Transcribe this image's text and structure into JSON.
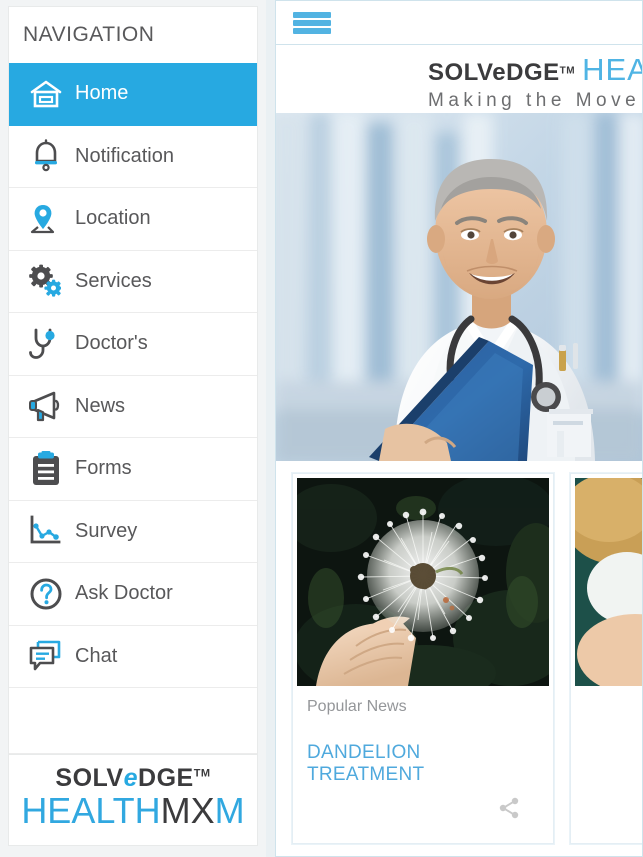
{
  "sidebar": {
    "header": "NAVIGATION",
    "items": [
      {
        "label": "Home",
        "icon": "home-icon",
        "active": true
      },
      {
        "label": "Notification",
        "icon": "bell-icon",
        "active": false
      },
      {
        "label": "Location",
        "icon": "map-pin-icon",
        "active": false
      },
      {
        "label": "Services",
        "icon": "gears-icon",
        "active": false
      },
      {
        "label": "Doctor's",
        "icon": "stethoscope-icon",
        "active": false
      },
      {
        "label": "News",
        "icon": "megaphone-icon",
        "active": false
      },
      {
        "label": "Forms",
        "icon": "clipboard-icon",
        "active": false
      },
      {
        "label": "Survey",
        "icon": "line-chart-icon",
        "active": false
      },
      {
        "label": "Ask Doctor",
        "icon": "question-mark-icon",
        "active": false
      },
      {
        "label": "Chat",
        "icon": "chat-bubble-icon",
        "active": false
      }
    ],
    "logo": {
      "solvedge_pre": "SOLV",
      "solvedge_e": "e",
      "solvedge_post": "DGE",
      "trademark": "TM",
      "health": "HEALTH",
      "mx": "MX",
      "m": "M"
    }
  },
  "topbar": {
    "menu_icon": "hamburger-menu-icon"
  },
  "brand": {
    "solvedge_pre": "SOLV",
    "solvedge_e": "e",
    "solvedge_post": "DGE",
    "trademark": "TM",
    "health_truncated": "HEAL",
    "tagline_truncated": "Making the Move t"
  },
  "hero": {
    "alt": "smiling doctor in white coat with stethoscope holding blue folder"
  },
  "cards": [
    {
      "kicker": "Popular News",
      "title": "DANDELION TREATMENT",
      "image_alt": "hand holding a white dandelion seed head",
      "share_icon": "share-icon"
    },
    {
      "kicker": "",
      "title": "",
      "image_alt": "partially visible second news card",
      "share_icon": "share-icon"
    }
  ],
  "colors": {
    "accent_blue": "#27a9e1",
    "hamburger_blue": "#52b3e2",
    "link_blue": "#4fa9dd",
    "text_gray": "#58585a",
    "kicker_gray": "#949699",
    "panel_border": "#cfe3ec",
    "page_bg": "#eaf0f3"
  }
}
